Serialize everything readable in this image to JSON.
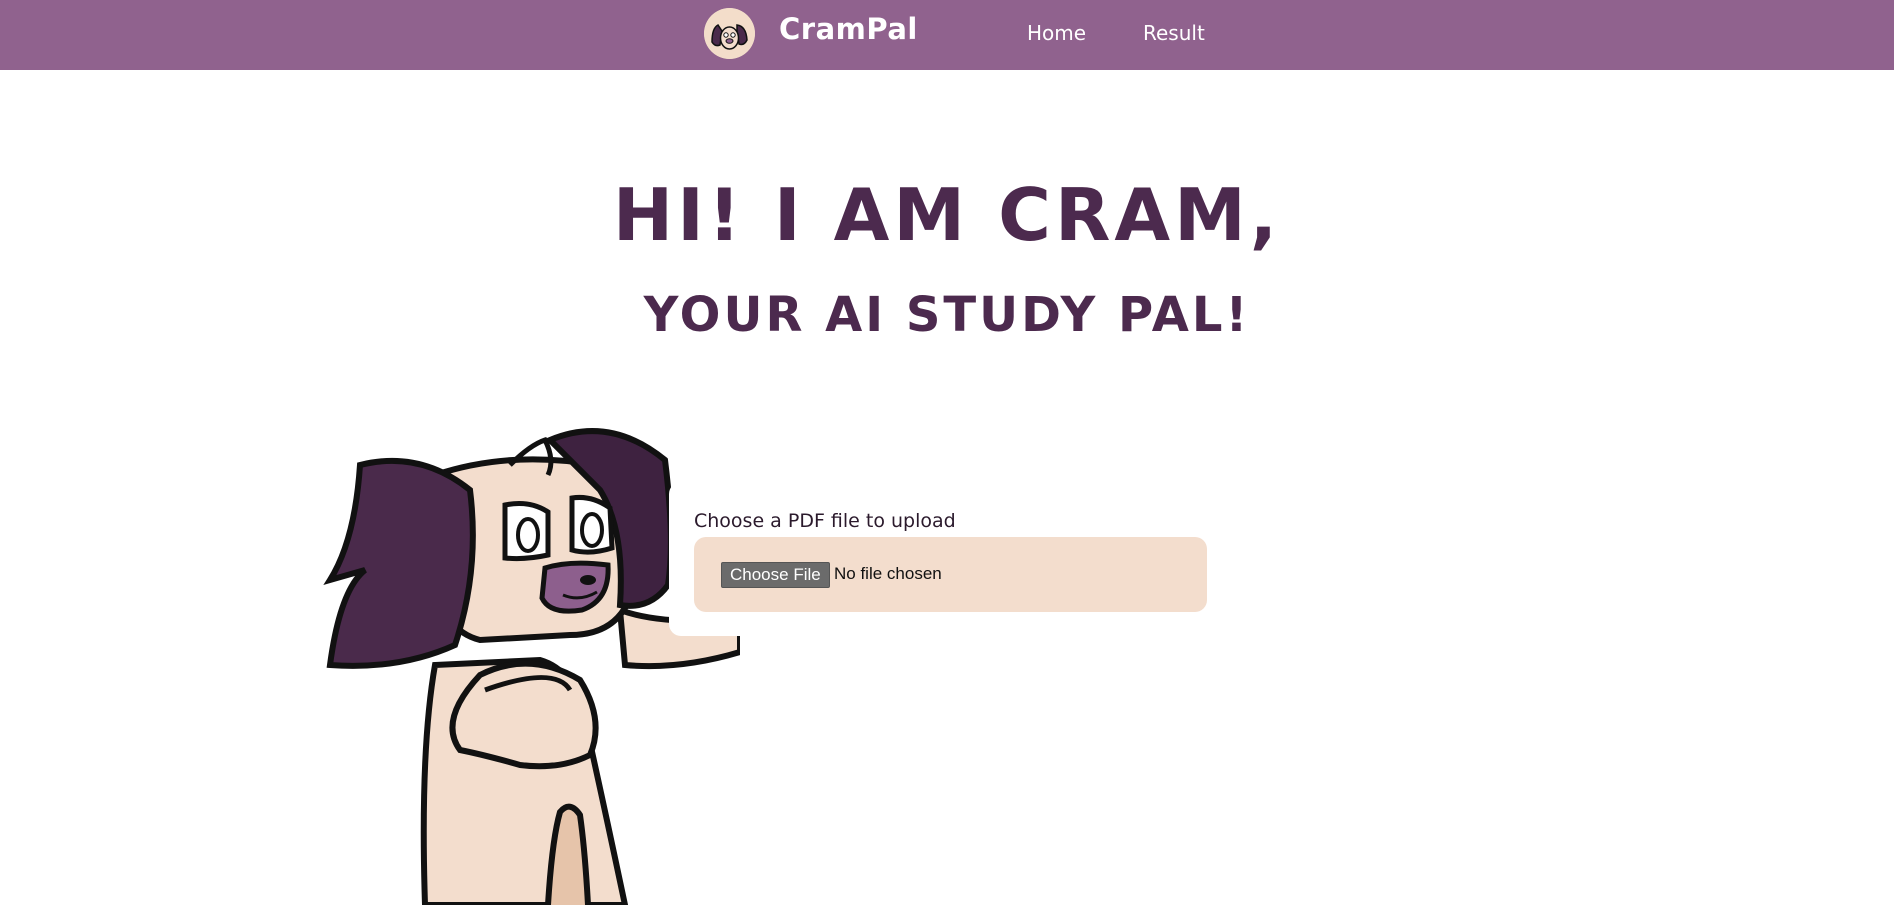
{
  "colors": {
    "nav_background": "#90628e",
    "heading": "#4c2a4e",
    "skin": "#f3ddcd",
    "ear_dark": "#4a2a4b",
    "nose": "#8d5f8d"
  },
  "navbar": {
    "logo_icon": "crampal-dog-logo-icon",
    "brand": "CramPal",
    "links": [
      {
        "label": "Home"
      },
      {
        "label": "Result"
      }
    ]
  },
  "hero": {
    "title": "HI! I AM CRAM,",
    "subtitle": "YOUR AI STUDY PAL!"
  },
  "mascot": {
    "icon": "cram-dog-mascot-icon"
  },
  "upload": {
    "label": "Choose a PDF file to upload",
    "button_label": "Choose File",
    "status": "No file chosen"
  }
}
